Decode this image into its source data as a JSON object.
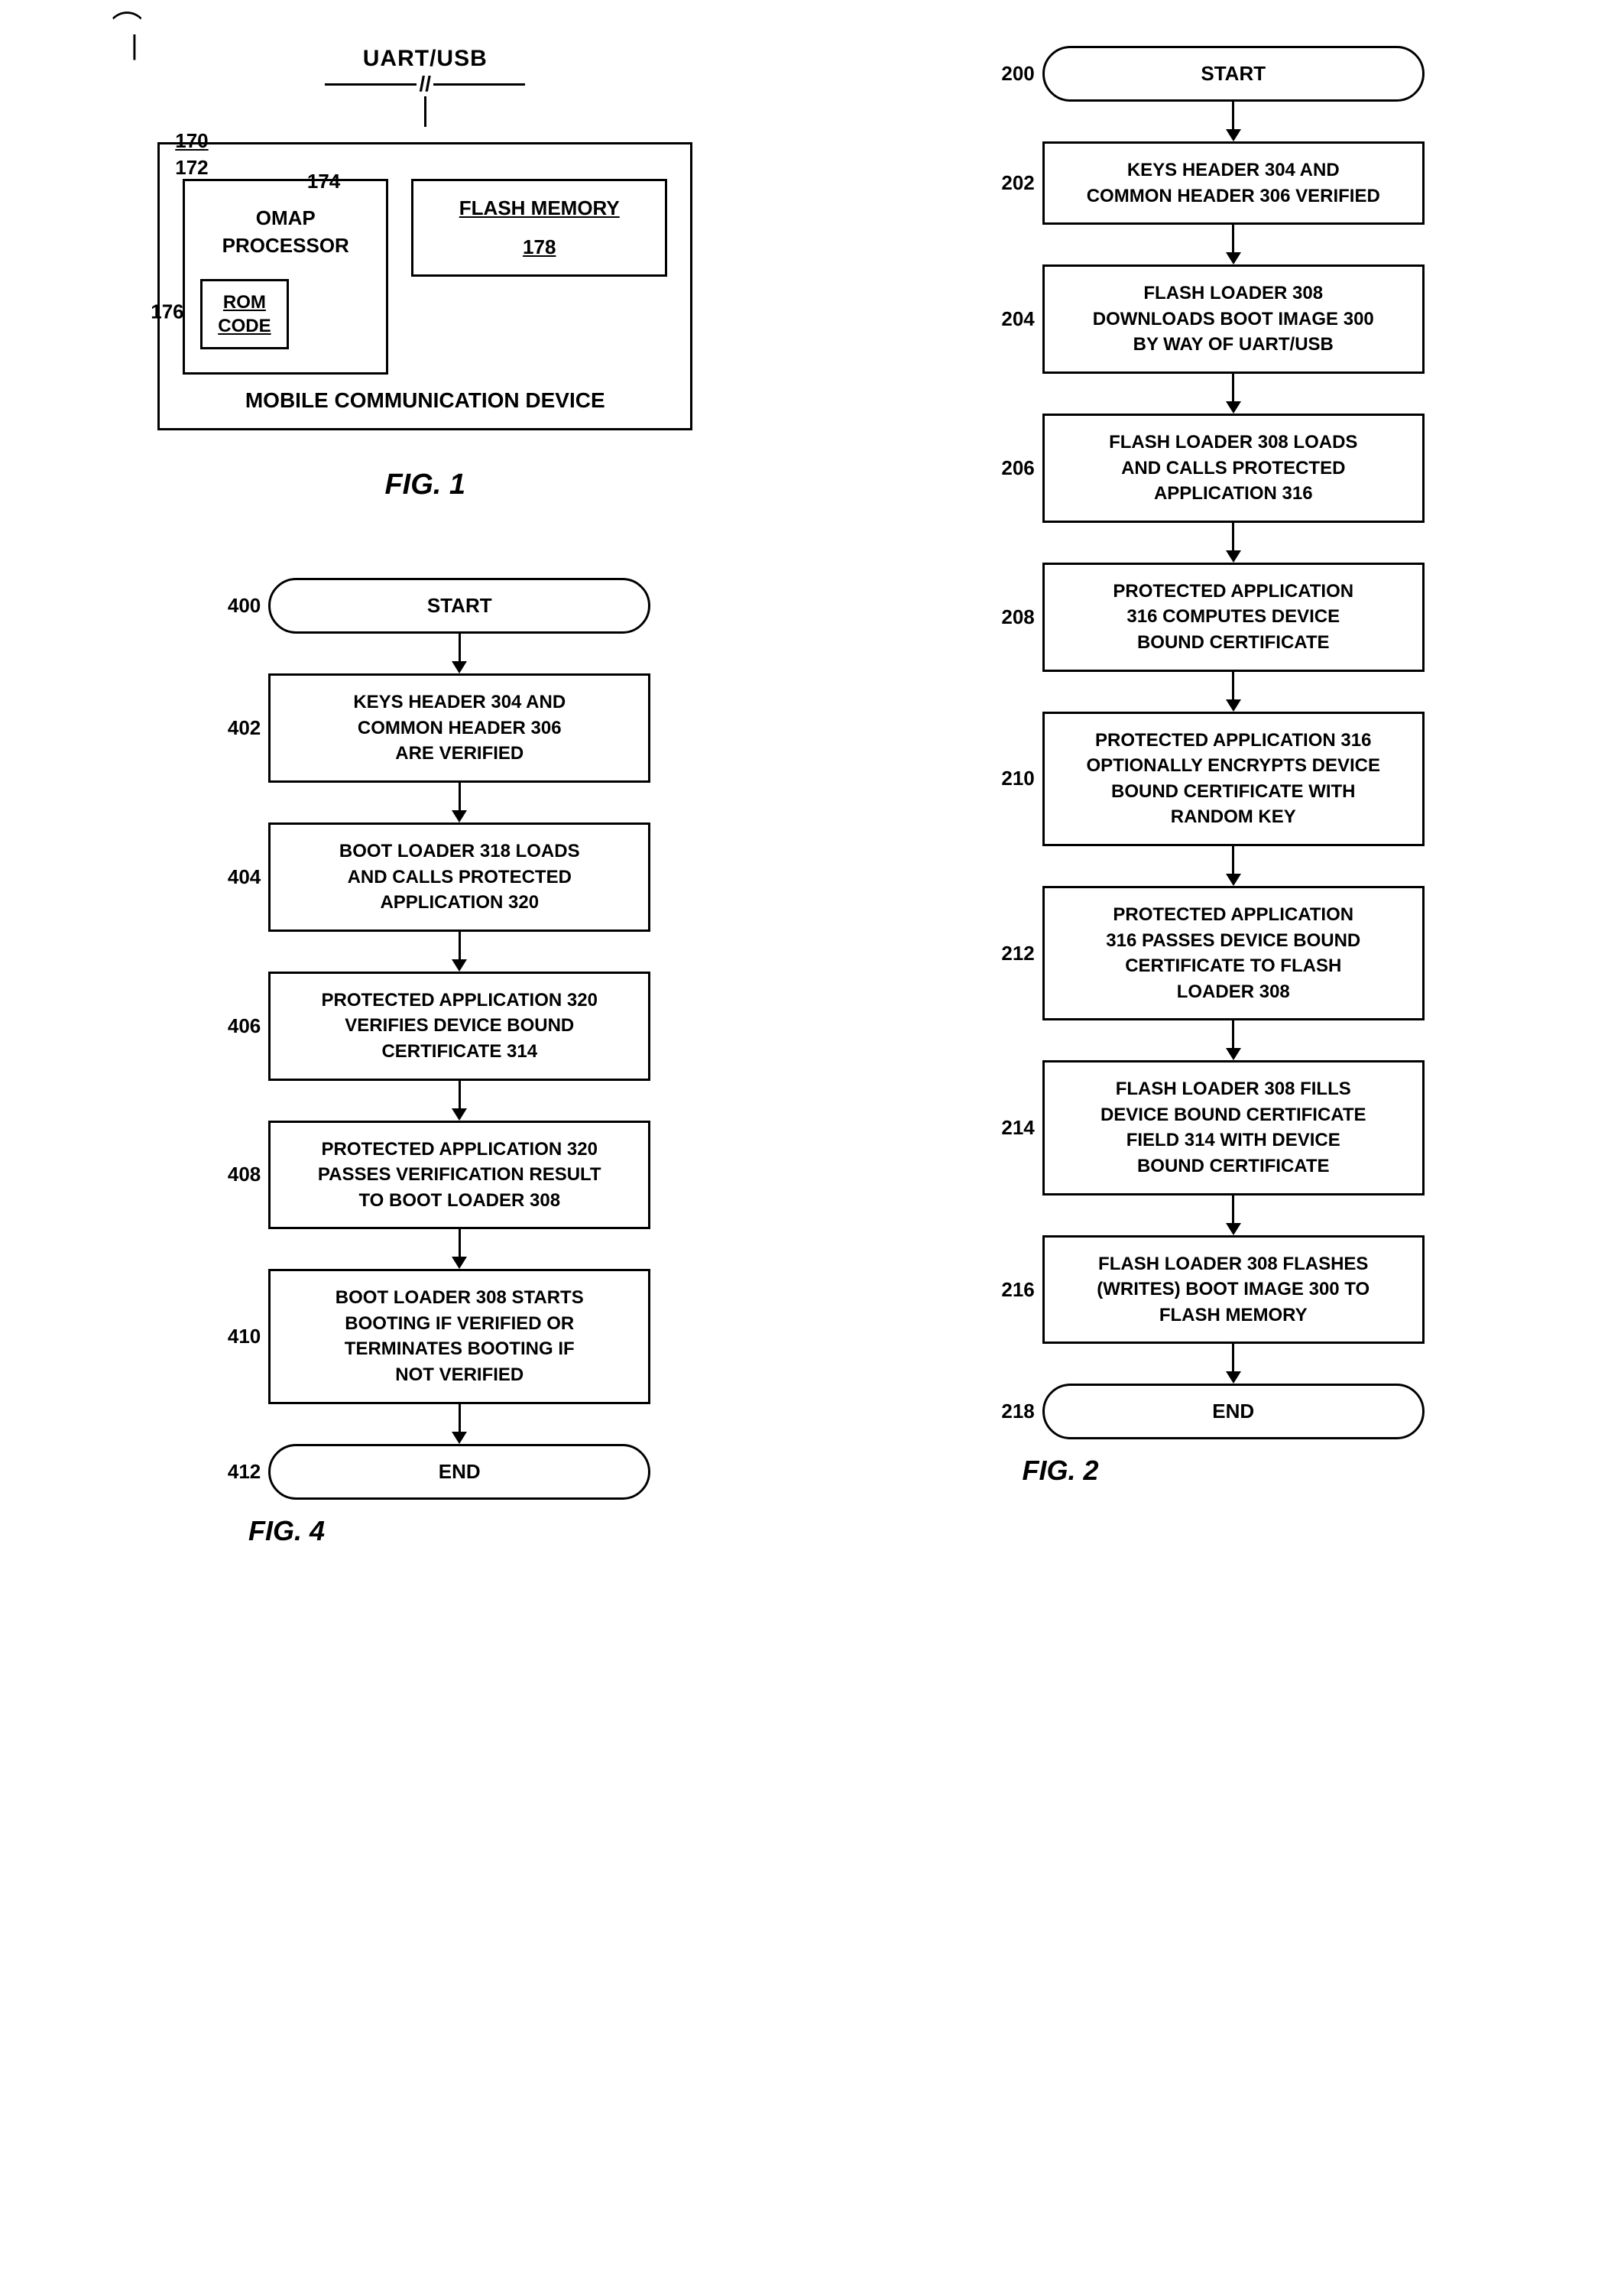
{
  "fig1": {
    "uart_label": "UART/USB",
    "device_num": "170",
    "processor_num": "172",
    "processor_label_ref": "174",
    "processor_name": "OMAP\nPROCESSOR",
    "rom_num": "176",
    "rom_label": "ROM\nCODE",
    "flash_label": "FLASH MEMORY",
    "flash_num": "178",
    "device_bottom": "MOBILE COMMUNICATION DEVICE",
    "caption": "FIG. 1"
  },
  "fig2": {
    "caption": "FIG. 2",
    "start_label": "START",
    "end_label": "END",
    "ref_start": "200",
    "steps": [
      {
        "ref": "202",
        "text": "KEYS HEADER 304 AND\nCOMMON HEADER 306 VERIFIED"
      },
      {
        "ref": "204",
        "text": "FLASH LOADER 308\nDOWNLOADS BOOT IMAGE 300\nBY WAY OF UART/USB"
      },
      {
        "ref": "206",
        "text": "FLASH LOADER 308 LOADS\nAND CALLS PROTECTED\nAPPLICATION 316"
      },
      {
        "ref": "208",
        "text": "PROTECTED APPLICATION\n316 COMPUTES DEVICE\nBOUND CERTIFICATE"
      },
      {
        "ref": "210",
        "text": "PROTECTED APPLICATION 316\nOPTIONALLY ENCRYPTS DEVICE\nBOUND CERTIFICATE WITH\nRANDOM KEY"
      },
      {
        "ref": "212",
        "text": "PROTECTED APPLICATION\n316 PASSES DEVICE BOUND\nCERTIFICATE TO FLASH\nLOADER 308"
      },
      {
        "ref": "214",
        "text": "FLASH LOADER 308 FILLS\nDEVICE BOUND CERTIFICATE\nFIELD 314 WITH DEVICE\nBOUND CERTIFICATE"
      },
      {
        "ref": "216",
        "text": "FLASH LOADER 308 FLASHES\n(WRITES) BOOT IMAGE 300 TO\nFLASH MEMORY"
      }
    ],
    "end_ref": "218"
  },
  "fig4": {
    "caption": "FIG. 4",
    "start_label": "START",
    "end_label": "END",
    "ref_start": "400",
    "steps": [
      {
        "ref": "402",
        "text": "KEYS HEADER 304 AND\nCOMMON HEADER 306\nARE VERIFIED"
      },
      {
        "ref": "404",
        "text": "BOOT LOADER 318 LOADS\nAND CALLS PROTECTED\nAPPLICATION 320"
      },
      {
        "ref": "406",
        "text": "PROTECTED APPLICATION 320\nVERIFIES DEVICE BOUND\nCERTIFICATE 314"
      },
      {
        "ref": "408",
        "text": "PROTECTED APPLICATION 320\nPASSES VERIFICATION RESULT\nTO BOOT LOADER 308"
      },
      {
        "ref": "410",
        "text": "BOOT LOADER 308 STARTS\nBOOTING IF VERIFIED OR\nTERMINATES BOOTING IF\nNOT VERIFIED"
      }
    ],
    "end_ref": "412"
  }
}
